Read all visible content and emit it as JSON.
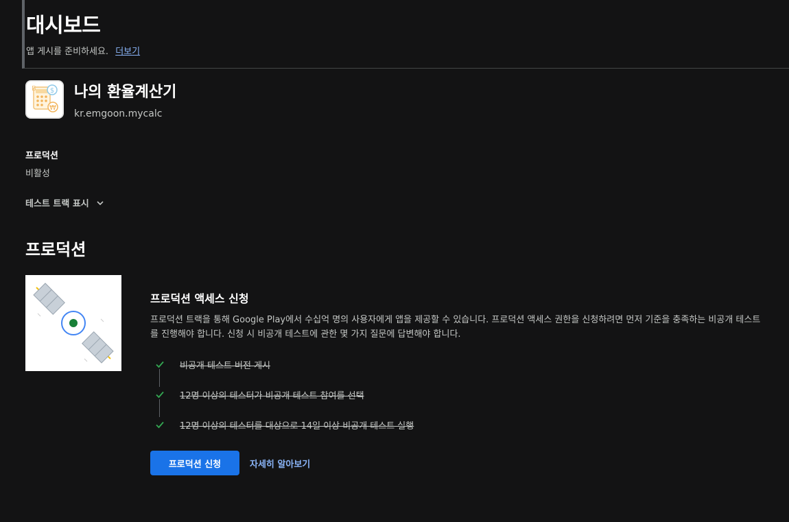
{
  "header": {
    "title": "대시보드",
    "subtitle": "앱 게시를 준비하세요.",
    "more_link": "더보기"
  },
  "app": {
    "name": "나의 환율계산기",
    "package": "kr.emgoon.mycalc",
    "icon": "calculator-currency-icon"
  },
  "production_status": {
    "label": "프로덕션",
    "value": "비활성"
  },
  "test_tracks_toggle": {
    "label": "테스트 트랙 표시",
    "icon": "chevron-down-icon"
  },
  "section": {
    "title": "프로덕션"
  },
  "card": {
    "title": "프로덕션 액세스 신청",
    "description": "프로덕션 트랙을 통해 Google Play에서 수십억 명의 사용자에게 앱을 제공할 수 있습니다. 프로덕션 액세스 권한을 신청하려면 먼저 기준을 충족하는 비공개 테스트를 진행해야 합니다. 신청 시 비공개 테스트에 관한 몇 가지 질문에 답변해야 합니다.",
    "steps": [
      {
        "label": "비공개 테스트 버전 게시",
        "completed": true
      },
      {
        "label": "12명 이상의 테스터가 비공개 테스트 참여를 선택",
        "completed": true
      },
      {
        "label": "12명 이상의 테스터를 대상으로 14일 이상 비공개 테스트 실행",
        "completed": true
      }
    ],
    "apply_button": "프로덕션 신청",
    "learn_more": "자세히 알아보기"
  },
  "colors": {
    "background": "#131314",
    "accent": "#1a73e8",
    "link": "#8ab4f8",
    "check": "#34a853"
  }
}
